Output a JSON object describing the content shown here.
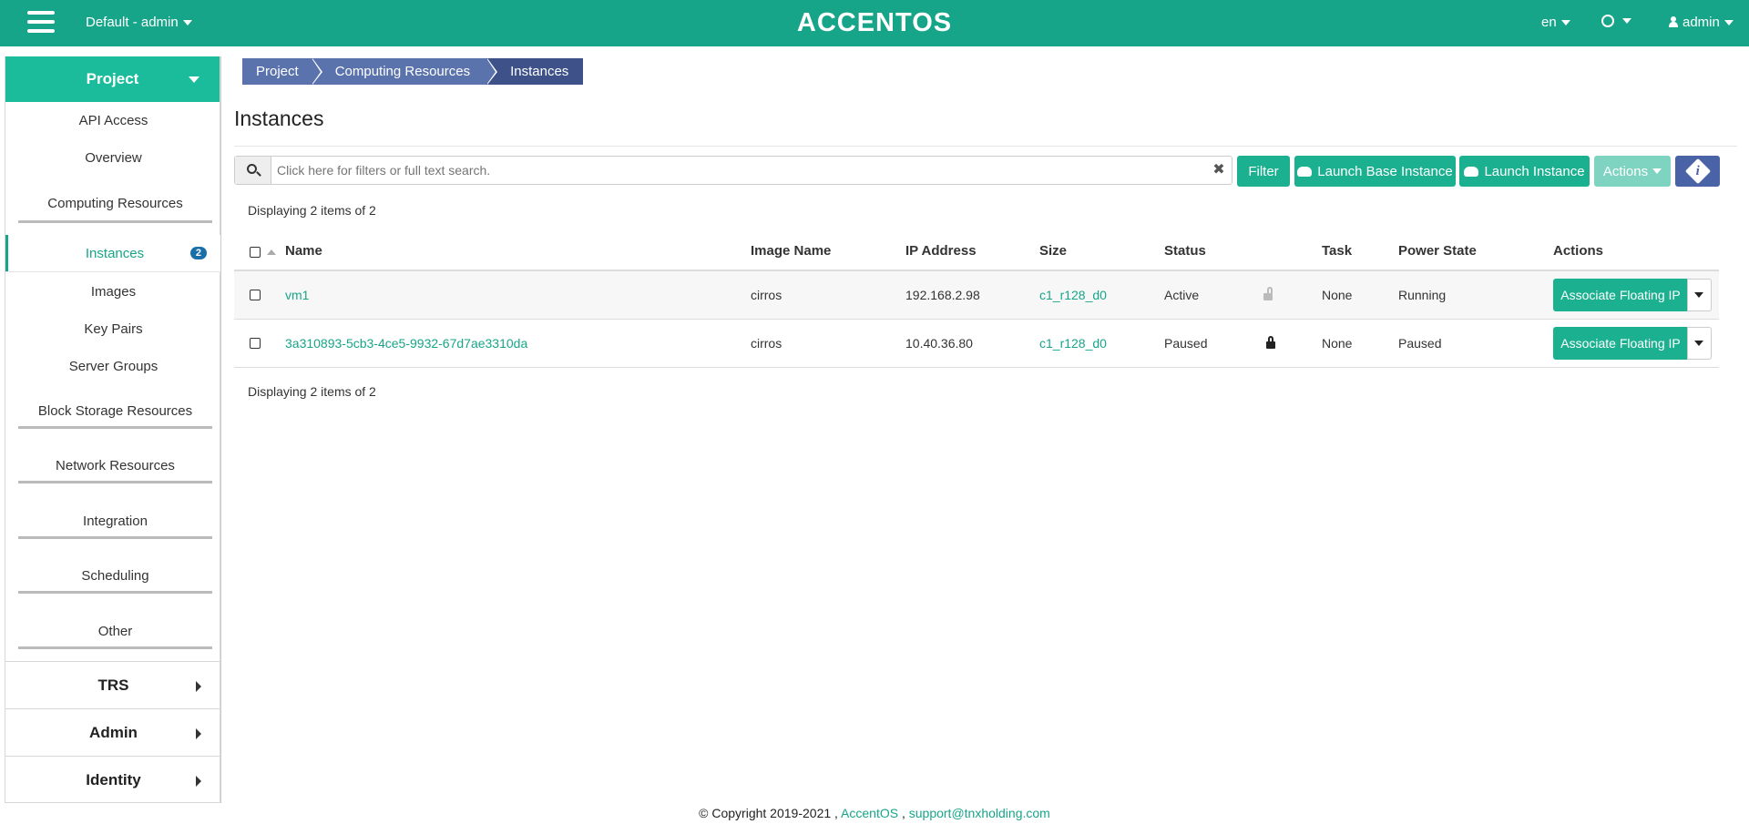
{
  "header": {
    "domain_selector": "Default - admin",
    "brand": "ACCENTOS",
    "language": "en",
    "user": "admin"
  },
  "sidebar": {
    "project": "Project",
    "items": [
      {
        "label": "API Access"
      },
      {
        "label": "Overview"
      }
    ],
    "computing_group": "Computing Resources",
    "instances": {
      "label": "Instances",
      "badge": "2"
    },
    "computing_items": [
      {
        "label": "Images"
      },
      {
        "label": "Key Pairs"
      },
      {
        "label": "Server Groups"
      }
    ],
    "groups": [
      {
        "label": "Block Storage Resources"
      },
      {
        "label": "Network Resources"
      },
      {
        "label": "Integration"
      },
      {
        "label": "Scheduling"
      },
      {
        "label": "Other"
      }
    ],
    "sections": [
      {
        "label": "TRS"
      },
      {
        "label": "Admin"
      },
      {
        "label": "Identity"
      }
    ]
  },
  "breadcrumb": [
    "Project",
    "Computing Resources",
    "Instances"
  ],
  "page_title": "Instances",
  "search": {
    "placeholder": "Click here for filters or full text search."
  },
  "toolbar": {
    "filter": "Filter",
    "launch_base": "Launch Base Instance",
    "launch": "Launch Instance",
    "actions": "Actions"
  },
  "display_count": "Displaying 2 items of 2",
  "table": {
    "columns": [
      "Name",
      "Image Name",
      "IP Address",
      "Size",
      "Status",
      "Task",
      "Power State",
      "Actions"
    ],
    "rows": [
      {
        "name": "vm1",
        "image": "cirros",
        "ip": "192.168.2.98",
        "size": "c1_r128_d0",
        "status": "Active",
        "locked": false,
        "task": "None",
        "power": "Running",
        "action": "Associate Floating IP"
      },
      {
        "name": "3a310893-5cb3-4ce5-9932-67d7ae3310da",
        "image": "cirros",
        "ip": "10.40.36.80",
        "size": "c1_r128_d0",
        "status": "Paused",
        "locked": true,
        "task": "None",
        "power": "Paused",
        "action": "Associate Floating IP"
      }
    ]
  },
  "footer": {
    "copyright": "© Copyright 2019-2021 ,",
    "company": "AccentOS",
    "separator": ",",
    "email": "support@tnxholding.com"
  },
  "colors": {
    "primary": "#17a589",
    "breadcrumb": "#5a73ad",
    "info": "#4a63a6"
  }
}
